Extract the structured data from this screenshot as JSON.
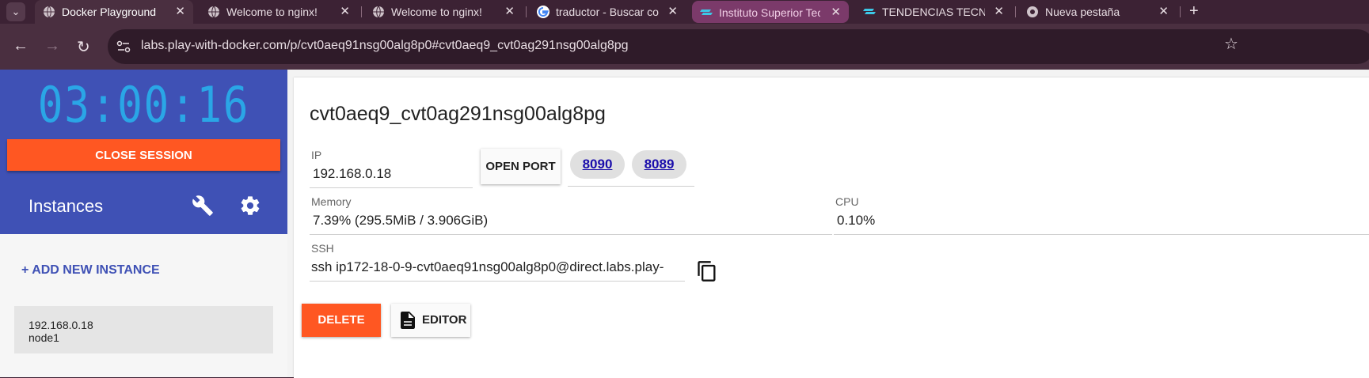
{
  "browser": {
    "tabs": [
      {
        "label": "Docker Playground",
        "icon": "globe-icon",
        "active": true
      },
      {
        "label": "Welcome to nginx!",
        "icon": "globe-icon"
      },
      {
        "label": "Welcome to nginx!",
        "icon": "globe-icon"
      },
      {
        "label": "traductor - Buscar co",
        "icon": "google-icon"
      },
      {
        "label": "Instituto Superior Tec",
        "icon": "stack-icon",
        "group": true
      },
      {
        "label": "TENDENCIAS TECNO",
        "icon": "stack-icon"
      },
      {
        "label": "Nueva pestaña",
        "icon": "chrome-icon"
      }
    ],
    "close_glyph": "✕",
    "new_tab_glyph": "+",
    "url": "labs.play-with-docker.com/p/cvt0aeq91nsg00alg8p0#cvt0aeq9_cvt0ag291nsg00alg8pg"
  },
  "sidebar": {
    "timer": "03:00:16",
    "close_session_label": "CLOSE SESSION",
    "instances_title": "Instances",
    "add_instance_label": "+ ADD NEW INSTANCE",
    "instances": [
      {
        "ip": "192.168.0.18",
        "name": "node1"
      }
    ]
  },
  "instance": {
    "hostname": "cvt0aeq9_cvt0ag291nsg00alg8pg",
    "ip_label": "IP",
    "ip_value": "192.168.0.18",
    "open_port_label": "OPEN PORT",
    "ports": [
      "8090",
      "8089"
    ],
    "memory_label": "Memory",
    "memory_value": "7.39% (295.5MiB / 3.906GiB)",
    "cpu_label": "CPU",
    "cpu_value": "0.10%",
    "ssh_label": "SSH",
    "ssh_value": "ssh ip172-18-0-9-cvt0aeq91nsg00alg8p0@direct.labs.play-",
    "delete_label": "DELETE",
    "editor_label": "EDITOR"
  },
  "colors": {
    "sidebar_header": "#3f51b5",
    "accent_orange": "#ff5722",
    "timer": "#2aa6e6",
    "browser_frame": "#3c2234",
    "tab_group": "#7b3a6a"
  }
}
